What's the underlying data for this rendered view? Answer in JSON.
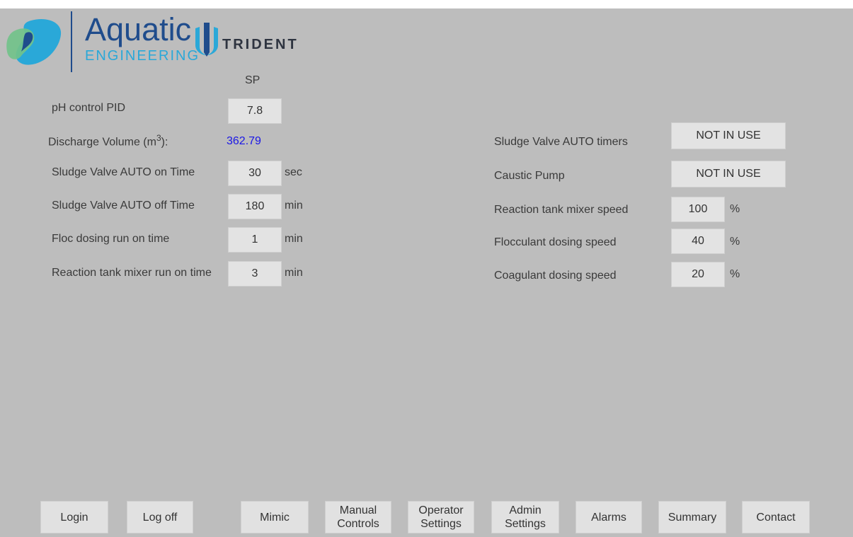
{
  "brand": {
    "name": "Aquatic",
    "subtitle": "ENGINEERING",
    "partner": "TRIDENT",
    "colors": {
      "blue": "#1f4c8c",
      "cyan": "#2aa8d8",
      "green": "#72c28a"
    }
  },
  "setpoint_header": "SP",
  "left": {
    "ph_label": "pH control PID",
    "ph_value": "7.8",
    "discharge_label": "Discharge Volume (m",
    "discharge_sup": "3",
    "discharge_suffix": "):",
    "discharge_value": "362.79",
    "sv_on_label": "Sludge Valve AUTO on Time",
    "sv_on_value": "30",
    "sv_on_unit": "sec",
    "sv_off_label": "Sludge Valve AUTO off Time",
    "sv_off_value": "180",
    "sv_off_unit": "min",
    "floc_label": "Floc dosing run on time",
    "floc_value": "1",
    "floc_unit": "min",
    "mixer_label": "Reaction tank mixer run on time",
    "mixer_value": "3",
    "mixer_unit": "min"
  },
  "right": {
    "sv_timers_label": "Sludge Valve AUTO timers",
    "sv_timers_value": "NOT IN USE",
    "caustic_label": "Caustic Pump",
    "caustic_value": "NOT IN USE",
    "rt_mixer_label": "Reaction tank mixer speed",
    "rt_mixer_value": "100",
    "rt_mixer_unit": "%",
    "floc_speed_label": "Flocculant dosing speed",
    "floc_speed_value": "40",
    "floc_speed_unit": "%",
    "coag_label": "Coagulant dosing speed",
    "coag_value": "20",
    "coag_unit": "%"
  },
  "nav": {
    "login": "Login",
    "logoff": "Log off",
    "mimic": "Mimic",
    "manual_1": "Manual",
    "manual_2": "Controls",
    "operator_1": "Operator",
    "operator_2": "Settings",
    "admin_1": "Admin",
    "admin_2": "Settings",
    "alarms": "Alarms",
    "summary": "Summary",
    "contact": "Contact"
  }
}
